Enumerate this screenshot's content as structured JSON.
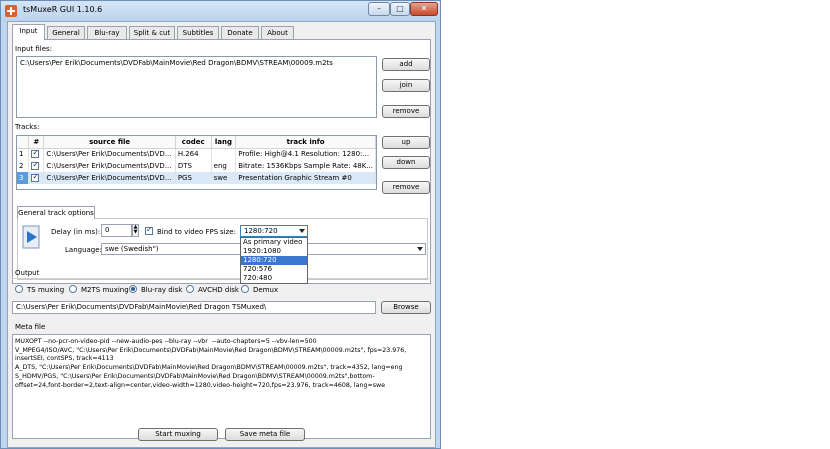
{
  "window": {
    "title": "tsMuxeR GUI 1.10.6",
    "minimize": "–",
    "maximize": "□",
    "close": "✕"
  },
  "tabs": [
    "Input",
    "General",
    "Blu-ray",
    "Split & cut",
    "Subtitles",
    "Donate",
    "About"
  ],
  "input": {
    "section_label": "Input files:",
    "files": [
      "C:\\Users\\Per Erik\\Documents\\DVDFab\\MainMovie\\Red Dragon\\BDMV\\STREAM\\00009.m2ts"
    ],
    "buttons": {
      "add": "add",
      "join": "join",
      "remove": "remove"
    }
  },
  "tracks": {
    "section_label": "Tracks:",
    "columns": [
      "#",
      "source file",
      "codec",
      "lang",
      "track info"
    ],
    "rows": [
      {
        "num": "1",
        "checked": true,
        "source": "C:\\Users\\Per Erik\\Documents\\DVD...",
        "codec": "H.264",
        "lang": "",
        "info": "Profile: High@4.1  Resolution: 1280:..."
      },
      {
        "num": "2",
        "checked": true,
        "source": "C:\\Users\\Per Erik\\Documents\\DVD...",
        "codec": "DTS",
        "lang": "eng",
        "info": "Bitrate: 1536Kbps  Sample Rate: 48K..."
      },
      {
        "num": "3",
        "checked": true,
        "source": "C:\\Users\\Per Erik\\Documents\\DVD...",
        "codec": "PGS",
        "lang": "swe",
        "info": "Presentation Graphic Stream #0"
      }
    ],
    "buttons": {
      "up": "up",
      "down": "down",
      "remove": "remove"
    }
  },
  "track_options": {
    "tab_label": "General track options",
    "delay_label": "Delay (in ms):",
    "delay_value": "0",
    "bind_label": "Bind to video FPS",
    "bind_checked": true,
    "size_label": "size:",
    "size_value": "1280:720",
    "size_options": [
      "As primary video",
      "1920:1080",
      "1280:720",
      "720:576",
      "720:480"
    ],
    "size_selected_index": 2,
    "language_label": "Language:",
    "language_value": "swe (Swedish\")"
  },
  "output": {
    "section_label": "Output",
    "modes": [
      "TS muxing",
      "M2TS muxing",
      "Blu-ray disk",
      "AVCHD disk",
      "Demux"
    ],
    "selected_mode_index": 2,
    "path": "C:\\Users\\Per Erik\\Documents\\DVDFab\\MainMovie\\Red Dragon TSMuxed\\",
    "browse": "Browse"
  },
  "meta": {
    "section_label": "Meta file",
    "content": "MUXOPT --no-pcr-on-video-pid --new-audio-pes --blu-ray --vbr  --auto-chapters=5 --vbv-len=500\nV_MPEG4/ISO/AVC, \"C:\\Users\\Per Erik\\Documents\\DVDFab\\MainMovie\\Red Dragon\\BDMV\\STREAM\\00009.m2ts\", fps=23.976,\ninsertSEI, contSPS, track=4113\nA_DTS, \"C:\\Users\\Per Erik\\Documents\\DVDFab\\MainMovie\\Red Dragon\\BDMV\\STREAM\\00009.m2ts\", track=4352, lang=eng\nS_HDMV/PGS, \"C:\\Users\\Per Erik\\Documents\\DVDFab\\MainMovie\\Red Dragon\\BDMV\\STREAM\\00009.m2ts\",bottom-\noffset=24,font-border=2,text-align=center,video-width=1280,video-height=720,fps=23.976, track=4608, lang=swe"
  },
  "actions": {
    "start": "Start muxing",
    "save_meta": "Save meta file"
  }
}
